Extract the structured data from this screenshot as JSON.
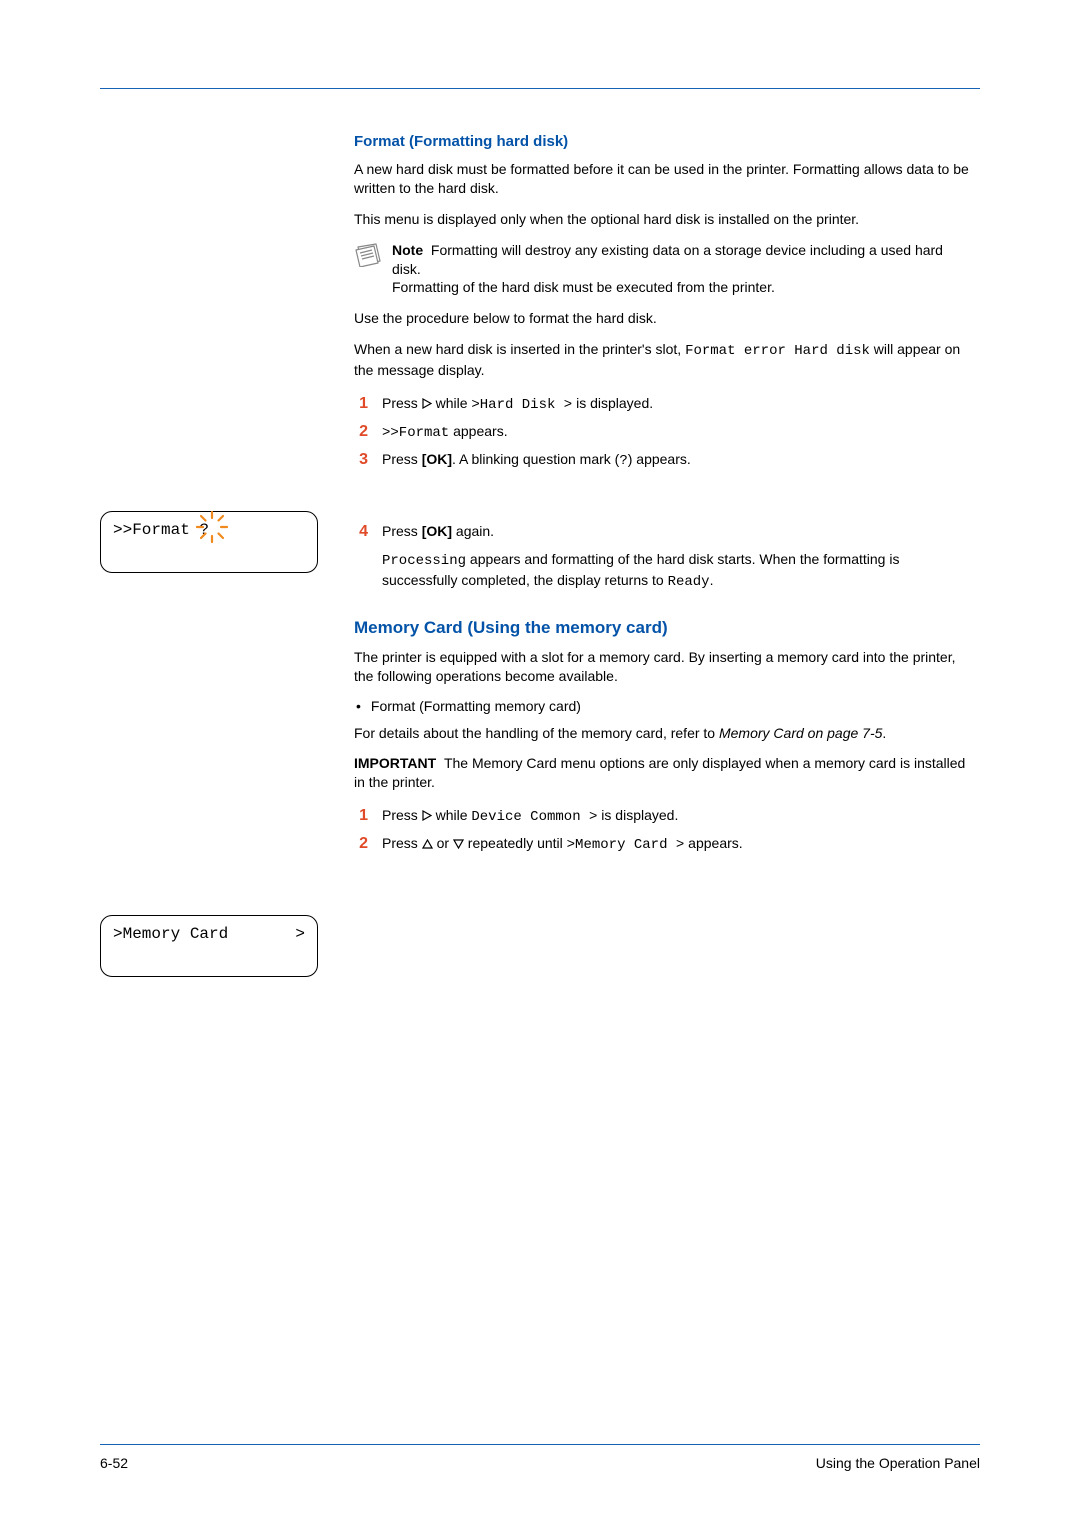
{
  "section1": {
    "heading": "Format (Formatting hard disk)",
    "p1": "A new hard disk must be formatted before it can be used in the printer. Formatting allows data to be written to the hard disk.",
    "p2": "This menu is displayed only when the optional hard disk is installed on the printer.",
    "note_label": "Note",
    "note_body1": "Formatting will destroy any existing data on a storage device including a used hard disk.",
    "note_body2": "Formatting of the hard disk must be executed from the printer.",
    "p3": "Use the procedure below to format the hard disk.",
    "p4a": "When a new hard disk is inserted in the printer's slot, ",
    "p4_code": "Format error Hard disk",
    "p4b": " will appear on the message display.",
    "step1a": "Press ",
    "step1b": " while ",
    "step1_code": ">Hard Disk >",
    "step1c": " is displayed.",
    "step2_code": ">>Format",
    "step2b": " appears.",
    "step3a": "Press ",
    "step3_ok": "[OK]",
    "step3b": ". A blinking question mark (",
    "step3_q": "?",
    "step3c": ") appears.",
    "step4a": "Press ",
    "step4_ok": "[OK]",
    "step4b": " again.",
    "step4_sub_code1": "Processing",
    "step4_sub_a": " appears and formatting of the hard disk starts. When the formatting is successfully completed, the display returns to ",
    "step4_sub_code2": "Ready",
    "step4_sub_b": "."
  },
  "lcd1": ">>Format ?",
  "lcd2_left": ">Memory Card",
  "lcd2_right": ">",
  "section2": {
    "heading": "Memory Card (Using the memory card)",
    "p1": "The printer is equipped with a slot for a memory card. By inserting a memory card into the printer, the following operations become available.",
    "bullet1": "Format (Formatting memory card)",
    "p2a": "For details about the handling of the memory card, refer to ",
    "p2_ref": "Memory Card on page 7-5",
    "p2b": ".",
    "imp_label": "IMPORTANT",
    "imp_body": "The Memory Card menu options are only displayed when a memory card is installed in the printer.",
    "step1a": "Press ",
    "step1b": " while ",
    "step1_code": "Device Common >",
    "step1c": " is displayed.",
    "step2a": "Press ",
    "step2b": " or ",
    "step2c": " repeatedly until ",
    "step2_code": ">Memory Card >",
    "step2d": " appears."
  },
  "footer": {
    "page": "6-52",
    "title": "Using the Operation Panel"
  }
}
